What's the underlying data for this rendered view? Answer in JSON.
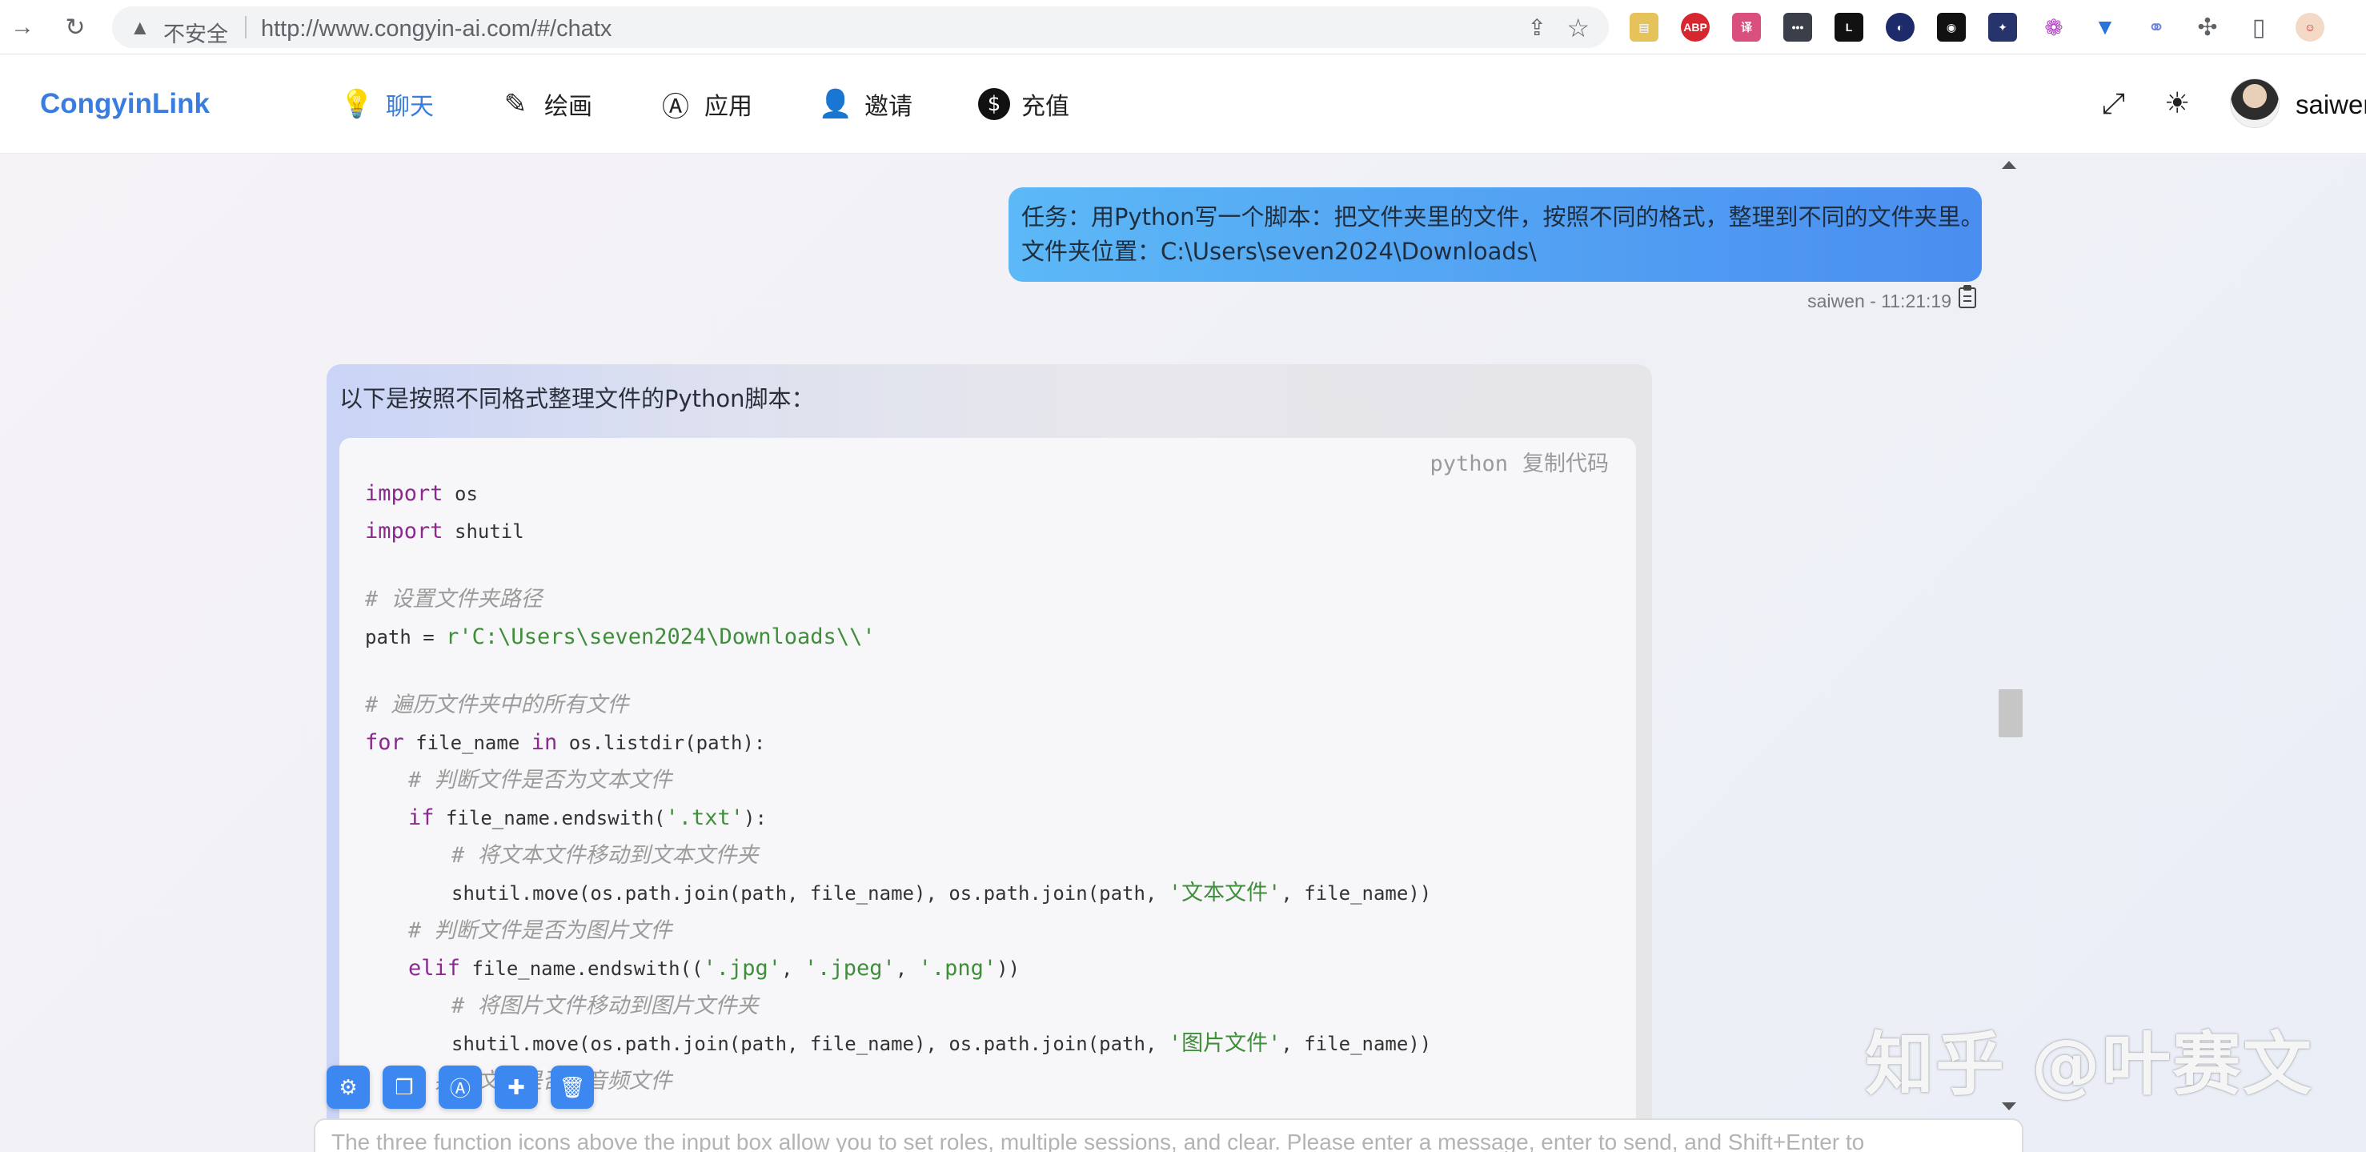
{
  "browser": {
    "insecure_label": "不安全",
    "url": "http://www.congyin-ai.com/#/chatx"
  },
  "header": {
    "brand": "CongyinLink",
    "menu": [
      {
        "label": "聊天",
        "icon": "lightbulb-icon"
      },
      {
        "label": "绘画",
        "icon": "pencil-icon"
      },
      {
        "label": "应用",
        "icon": "app-store-icon"
      },
      {
        "label": "邀请",
        "icon": "add-user-icon"
      },
      {
        "label": "充值",
        "icon": "dollar-icon"
      }
    ],
    "username": "saiwen",
    "active_color": "#3a7de0"
  },
  "chat": {
    "user_message": {
      "line1": "任务：用Python写一个脚本：把文件夹里的文件，按照不同的格式，整理到不同的文件夹里。",
      "line2": "文件夹位置：C:\\Users\\seven2024\\Downloads\\",
      "meta": "saiwen - 11:21:19"
    },
    "ai_message": {
      "intro": "以下是按照不同格式整理文件的Python脚本：",
      "code_lang": "python",
      "copy_label": "复制代码",
      "code": [
        {
          "indent": 0,
          "parts": [
            [
              "kw",
              "import"
            ],
            [
              "n",
              " os"
            ]
          ]
        },
        {
          "indent": 0,
          "parts": [
            [
              "kw",
              "import"
            ],
            [
              "n",
              " shutil"
            ]
          ]
        },
        {
          "indent": 0,
          "parts": []
        },
        {
          "indent": 0,
          "parts": [
            [
              "cm",
              "# 设置文件夹路径"
            ]
          ]
        },
        {
          "indent": 0,
          "parts": [
            [
              "n",
              "path = "
            ],
            [
              "str",
              "r'C:\\Users\\seven2024\\Downloads\\\\'"
            ]
          ]
        },
        {
          "indent": 0,
          "parts": []
        },
        {
          "indent": 0,
          "parts": [
            [
              "cm",
              "# 遍历文件夹中的所有文件"
            ]
          ]
        },
        {
          "indent": 0,
          "parts": [
            [
              "kw",
              "for"
            ],
            [
              "n",
              " file_name "
            ],
            [
              "kw",
              "in"
            ],
            [
              "n",
              " os.listdir(path):"
            ]
          ]
        },
        {
          "indent": 1,
          "parts": [
            [
              "cm",
              "# 判断文件是否为文本文件"
            ]
          ]
        },
        {
          "indent": 1,
          "parts": [
            [
              "kw",
              "if"
            ],
            [
              "n",
              " file_name.endswith("
            ],
            [
              "str",
              "'.txt'"
            ],
            [
              "n",
              "):"
            ]
          ]
        },
        {
          "indent": 2,
          "parts": [
            [
              "cm",
              "# 将文本文件移动到文本文件夹"
            ]
          ]
        },
        {
          "indent": 2,
          "parts": [
            [
              "n",
              "shutil.move(os.path.join(path, file_name), os.path.join(path, "
            ],
            [
              "str",
              "'文本文件'"
            ],
            [
              "n",
              ", file_name))"
            ]
          ]
        },
        {
          "indent": 1,
          "parts": [
            [
              "cm",
              "# 判断文件是否为图片文件"
            ]
          ]
        },
        {
          "indent": 1,
          "parts": [
            [
              "kw",
              "elif"
            ],
            [
              "n",
              " file_name.endswith(("
            ],
            [
              "str",
              "'.jpg'"
            ],
            [
              "n",
              ", "
            ],
            [
              "str",
              "'.jpeg'"
            ],
            [
              "n",
              ", "
            ],
            [
              "str",
              "'.png'"
            ],
            [
              "n",
              "))"
            ]
          ]
        },
        {
          "indent": 2,
          "parts": [
            [
              "cm",
              "# 将图片文件移动到图片文件夹"
            ]
          ]
        },
        {
          "indent": 2,
          "parts": [
            [
              "n",
              "shutil.move(os.path.join(path, file_name), os.path.join(path, "
            ],
            [
              "str",
              "'图片文件'"
            ],
            [
              "n",
              ", file_name))"
            ]
          ]
        },
        {
          "indent": 1,
          "parts": [
            [
              "cm",
              "# 判断文件是否为音频文件"
            ]
          ]
        }
      ]
    }
  },
  "toolbar_buttons": [
    {
      "name": "settings-button",
      "icon": "gear-icon",
      "glyph": "⚙"
    },
    {
      "name": "sessions-button",
      "icon": "chat-bubbles-icon",
      "glyph": "❐"
    },
    {
      "name": "apps-button",
      "icon": "app-store-icon",
      "glyph": "A"
    },
    {
      "name": "new-chat-button",
      "icon": "comment-add-icon",
      "glyph": "✚"
    },
    {
      "name": "clear-button",
      "icon": "trash-icon",
      "glyph": "🗑"
    }
  ],
  "input": {
    "placeholder": "The three function icons above the input box allow you to set roles, multiple sessions, and clear. Please enter a message, enter to send, and Shift+Enter to"
  },
  "watermark": "知乎 @叶赛文"
}
